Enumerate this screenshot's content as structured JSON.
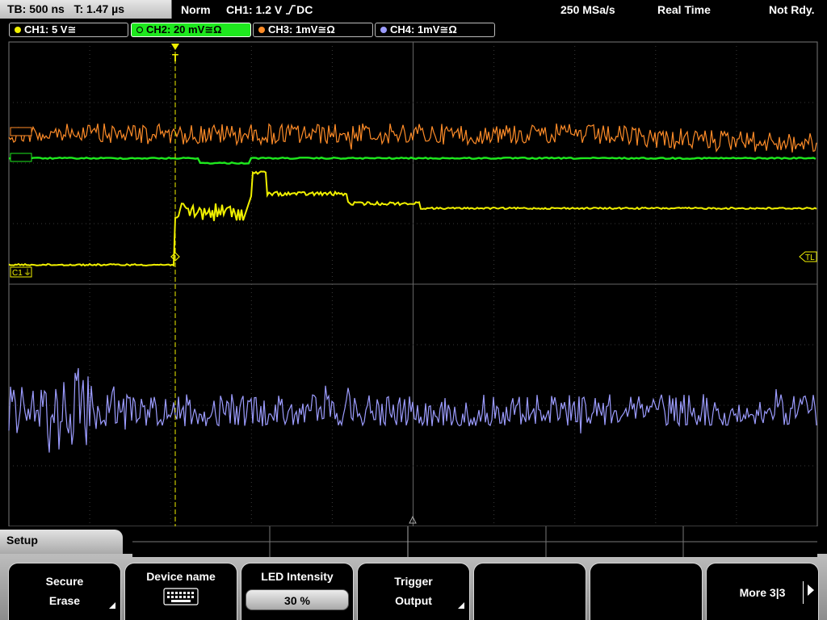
{
  "status": {
    "timebase": "TB: 500 ns",
    "trigger_time": "T: 1.47 µs",
    "mode": "Norm",
    "trigger_info": "CH1: 1.2 V",
    "trigger_coupling": "DC",
    "sample_rate": "250 MSa/s",
    "acq_mode": "Real Time",
    "state": "Not Rdy."
  },
  "channels": [
    {
      "label": "CH1: 5 V",
      "suffix": "≅",
      "color": "#f0f000",
      "active": false
    },
    {
      "label": "CH2: 20 mV",
      "suffix": "≅Ω",
      "color": "#1ee81e",
      "active": true
    },
    {
      "label": "CH3: 1mV",
      "suffix": "≅Ω",
      "color": "#ff8c28",
      "active": false
    },
    {
      "label": "CH4: 1mV",
      "suffix": "≅Ω",
      "color": "#9c9cff",
      "active": false
    }
  ],
  "markers": {
    "ch1_ground": "C1",
    "trigger_level": "TL",
    "trigger_position": "T"
  },
  "menu": {
    "title": "Setup",
    "softkeys": [
      {
        "line1": "Secure",
        "line2": "Erase",
        "has_submenu": true
      },
      {
        "line1": "Device name",
        "icon": "keyboard-icon"
      },
      {
        "line1": "LED Intensity",
        "value": "30 %"
      },
      {
        "line1": "Trigger",
        "line2": "Output",
        "has_submenu": true
      },
      {
        "line1": ""
      },
      {
        "line1": ""
      },
      {
        "line1": "More 3|3",
        "has_next": true
      }
    ]
  }
}
